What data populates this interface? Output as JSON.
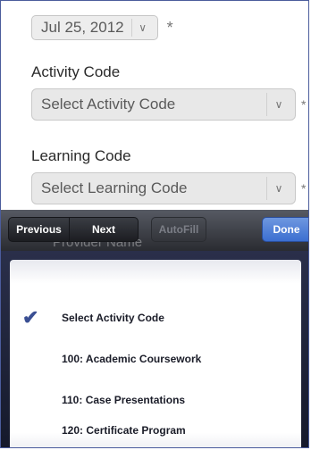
{
  "form": {
    "date": {
      "value": "Jul 25, 2012",
      "chevron": "∨",
      "required_mark": "*"
    },
    "activity_code": {
      "label": "Activity Code",
      "placeholder": "Select Activity Code",
      "chevron": "∨",
      "required_mark": "*"
    },
    "learning_code": {
      "label": "Learning Code",
      "placeholder": "Select Learning Code",
      "chevron": "∨",
      "required_mark": "*"
    },
    "provider_name": {
      "label": "Provider Name"
    }
  },
  "toolbar": {
    "previous": "Previous",
    "next": "Next",
    "autofill": "AutoFill",
    "done": "Done"
  },
  "picker": {
    "selected_index": 0,
    "check_icon": "✔",
    "options": [
      "Select Activity Code",
      "100: Academic Coursework",
      "110: Case Presentations",
      "120: Certificate Program"
    ]
  }
}
